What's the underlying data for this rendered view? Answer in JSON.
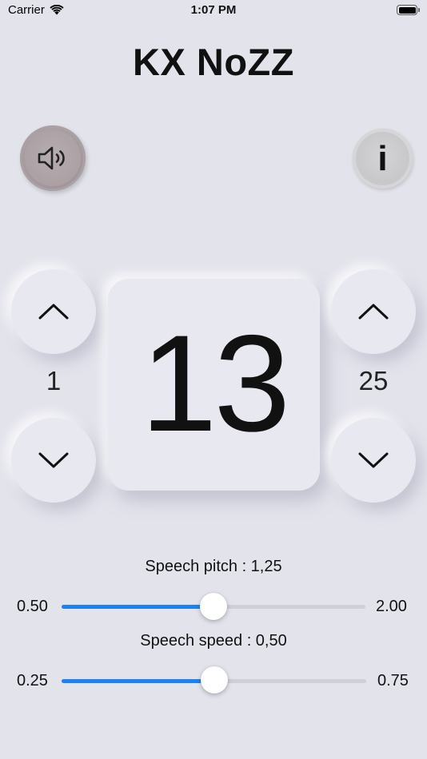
{
  "status_bar": {
    "carrier": "Carrier",
    "time": "1:07 PM",
    "battery_level_percent": 100
  },
  "app": {
    "title": "KX NoZZ"
  },
  "controls": {
    "sound_icon": "speaker-icon",
    "info_icon": "info-icon",
    "info_label": "i"
  },
  "counter": {
    "current": "13",
    "min_value": "1",
    "max_value": "25"
  },
  "sliders": {
    "pitch": {
      "caption": "Speech pitch  : 1,25",
      "min_label": "0.50",
      "max_label": "2.00",
      "value": 1.25,
      "min": 0.5,
      "max": 2.0
    },
    "speed": {
      "caption": "Speech speed  : 0,50",
      "min_label": "0.25",
      "max_label": "0.75",
      "value": 0.5,
      "min": 0.25,
      "max": 0.75
    }
  },
  "colors": {
    "background": "#e3e3ec",
    "accent": "#1a82f6",
    "sound_button": "#a69b9e",
    "info_button": "#c9c9cc"
  }
}
